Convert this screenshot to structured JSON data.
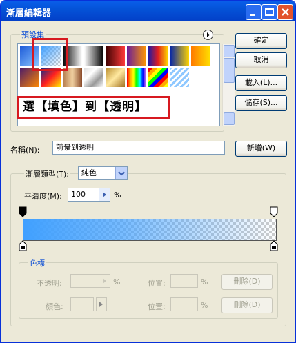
{
  "window": {
    "title": "漸層編輯器"
  },
  "presets": {
    "label": "預設集",
    "swatches": [
      "linear-gradient(135deg,#1E5BD8,#88C5FF)",
      "linear-gradient(135deg,#4AA7FF,#d9ecff)",
      "linear-gradient(90deg,#000,#fff)",
      "linear-gradient(90deg,#fff,#000)",
      "linear-gradient(90deg,#3c0000,#ff3a3a)",
      "linear-gradient(90deg,#6a1b9a,#ff9800)",
      "linear-gradient(90deg,#1a1aa6,#e01f1f,#ffd200)",
      "linear-gradient(90deg,#0022aa,#ffd400)",
      "linear-gradient(90deg,#ff7a00,#ffe000)",
      "linear-gradient(135deg,#4a1a6a,#ff8800)",
      "linear-gradient(135deg,#0a2a8a,#ff2020,#ffee00)",
      "linear-gradient(90deg,#b47a4a,#f0d0a0,#8a4a2a)",
      "linear-gradient(135deg,#ddd,#fff,#999,#fff)",
      "linear-gradient(135deg,#b88a2a,#ffe9a0,#a07020)",
      "linear-gradient(90deg,red,orange,yellow,lime,cyan,blue,violet)",
      "repeating-linear-gradient(135deg,red 0 5px,orange 5px 10px,yellow 10px 15px,lime 15px 20px,blue 20px 25px)",
      "repeating-linear-gradient(135deg,#8fc8ff 0 3px,#fff 3px 6px)"
    ],
    "overlay_text": "選【填色】到【透明】"
  },
  "buttons": {
    "ok": "確定",
    "cancel": "取消",
    "load": "載入(L)...",
    "save": "儲存(S)...",
    "new": "新增(W)"
  },
  "name": {
    "label": "名稱(N):",
    "value": "前景到透明"
  },
  "gradient": {
    "type_label": "漸層類型(T):",
    "type_value": "純色",
    "smooth_label": "平滑度(M):",
    "smooth_value": "100",
    "percent": "%"
  },
  "stops": {
    "label": "色標",
    "opacity_label": "不透明:",
    "color_label": "顏色:",
    "location_label": "位置:",
    "location_label2": "位置:",
    "percent": "%",
    "percent2": "%",
    "percent3": "%",
    "delete": "刪除(D)",
    "delete2": "刪除(D)"
  }
}
